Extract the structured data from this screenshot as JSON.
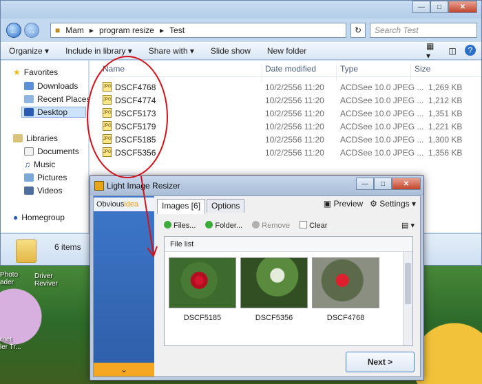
{
  "explorer": {
    "breadcrumb": [
      "Mam",
      "program resize",
      "Test"
    ],
    "search_placeholder": "Search Test",
    "toolbar": [
      "Organize",
      "Include in library",
      "Share with",
      "Slide show",
      "New folder"
    ],
    "nav": {
      "favorites_label": "Favorites",
      "favorites": [
        "Downloads",
        "Recent Places",
        "Desktop"
      ],
      "libraries_label": "Libraries",
      "libraries": [
        "Documents",
        "Music",
        "Pictures",
        "Videos"
      ],
      "homegroup_label": "Homegroup"
    },
    "columns": [
      "Name",
      "Date modified",
      "Type",
      "Size"
    ],
    "files": [
      {
        "name": "DSCF4768",
        "date": "10/2/2556 11:20",
        "type": "ACDSee 10.0 JPEG ...",
        "size": "1,269 KB"
      },
      {
        "name": "DSCF4774",
        "date": "10/2/2556 11:20",
        "type": "ACDSee 10.0 JPEG ...",
        "size": "1,212 KB"
      },
      {
        "name": "DSCF5173",
        "date": "10/2/2556 11:20",
        "type": "ACDSee 10.0 JPEG ...",
        "size": "1,351 KB"
      },
      {
        "name": "DSCF5179",
        "date": "10/2/2556 11:20",
        "type": "ACDSee 10.0 JPEG ...",
        "size": "1,221 KB"
      },
      {
        "name": "DSCF5185",
        "date": "10/2/2556 11:20",
        "type": "ACDSee 10.0 JPEG ...",
        "size": "1,300 KB"
      },
      {
        "name": "DSCF5356",
        "date": "10/2/2556 11:20",
        "type": "ACDSee 10.0 JPEG ...",
        "size": "1,356 KB"
      }
    ],
    "item_count": "6 items"
  },
  "desktop": {
    "icon_labels": [
      "Photo\nader",
      "Driver\nReviver",
      "rnet\nler Tr..."
    ]
  },
  "resizer": {
    "title": "Light Image Resizer",
    "logo_prefix": "Obvious",
    "logo_suffix": "idea",
    "tabs": [
      "Images [6]",
      "Options"
    ],
    "preview": "Preview",
    "settings": "Settings",
    "actions": [
      "Files...",
      "Folder...",
      "Remove",
      "Clear"
    ],
    "file_list_label": "File list",
    "thumbnails": [
      "DSCF5185",
      "DSCF5356",
      "DSCF4768"
    ],
    "next": "Next >"
  },
  "colors": {
    "accent": "#3c7ec9",
    "annotation": "#d0121b",
    "sidebar_blue": "#2d5ea8",
    "sidebar_orange": "#f5a623"
  }
}
